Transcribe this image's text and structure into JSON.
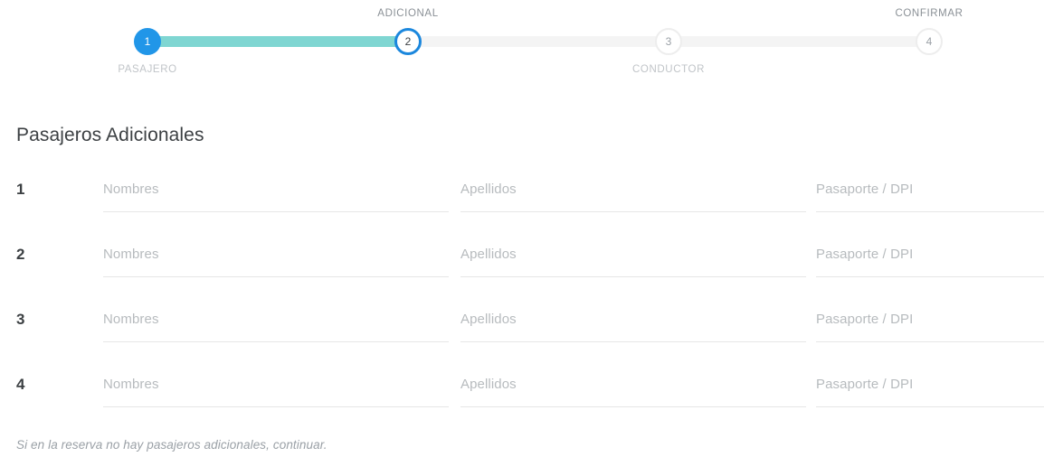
{
  "stepper": {
    "steps": [
      {
        "number": "1",
        "label": "PASAJERO",
        "state": "complete",
        "label_pos": "below"
      },
      {
        "number": "2",
        "label": "ADICIONAL",
        "state": "active",
        "label_pos": "above"
      },
      {
        "number": "3",
        "label": "CONDUCTOR",
        "state": "pending",
        "label_pos": "below"
      },
      {
        "number": "4",
        "label": "CONFIRMAR",
        "state": "pending",
        "label_pos": "above"
      }
    ],
    "colors": {
      "complete_fill": "#2196e8",
      "active_ring": "#1b87dd",
      "done_connector": "#7fd6d2",
      "todo_connector": "#f4f4f4",
      "pending_ring": "#ededed"
    }
  },
  "main": {
    "title": "Pasajeros Adicionales",
    "columns": [
      "Nombres",
      "Apellidos",
      "Pasaporte / DPI"
    ],
    "passengers": [
      {
        "num": "1",
        "nombres": "",
        "apellidos": "",
        "pasaporte": ""
      },
      {
        "num": "2",
        "nombres": "",
        "apellidos": "",
        "pasaporte": ""
      },
      {
        "num": "3",
        "nombres": "",
        "apellidos": "",
        "pasaporte": ""
      },
      {
        "num": "4",
        "nombres": "",
        "apellidos": "",
        "pasaporte": ""
      }
    ],
    "note": "Si en la reserva no hay pasajeros adicionales, continuar."
  }
}
